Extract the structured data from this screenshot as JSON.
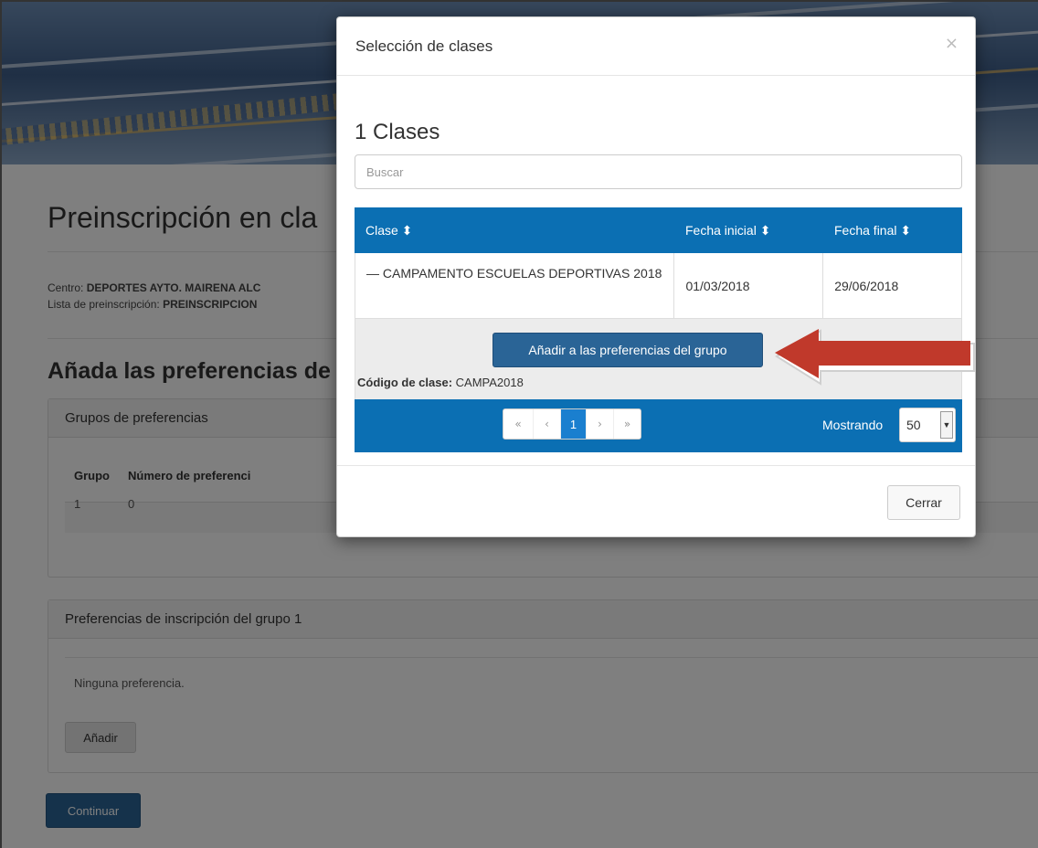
{
  "page": {
    "title": "Preinscripción en cla",
    "centro_label": "Centro: ",
    "centro_value": "DEPORTES AYTO. MAIRENA ALC",
    "lista_label": "Lista de preinscripción: ",
    "lista_value": "PREINSCRIPCION",
    "subtitle": "Añada las preferencias de",
    "groups_panel": {
      "header": "Grupos de preferencias",
      "columns": [
        "Grupo",
        "Número de preferenci"
      ],
      "rows": [
        [
          "1",
          "0"
        ]
      ]
    },
    "prefs_panel": {
      "header": "Preferencias de inscripción del grupo 1",
      "empty_text": "Ninguna preferencia.",
      "add_label": "Añadir"
    },
    "continue_label": "Continuar"
  },
  "modal": {
    "title": "Selección de clases",
    "close_symbol": "×",
    "count_text": "1 Clases",
    "search_placeholder": "Buscar",
    "columns": [
      "Clase ⬍",
      "Fecha inicial ⬍",
      "Fecha final ⬍"
    ],
    "row": {
      "clase": "— CAMPAMENTO ESCUELAS DEPORTIVAS 2018",
      "fecha_inicial": "01/03/2018",
      "fecha_final": "29/06/2018"
    },
    "add_pref_label": "Añadir a las preferencias del grupo",
    "code_label": "Código de clase:",
    "code_value": "CAMPA2018",
    "pager": [
      "«",
      "‹",
      "1",
      "›",
      "»"
    ],
    "showing_label": "Mostrando",
    "showing_value": "50",
    "close_button": "Cerrar"
  },
  "colors": {
    "table_header": "#0b6fb3",
    "primary_button": "#2a6496",
    "arrow": "#c0392b"
  }
}
